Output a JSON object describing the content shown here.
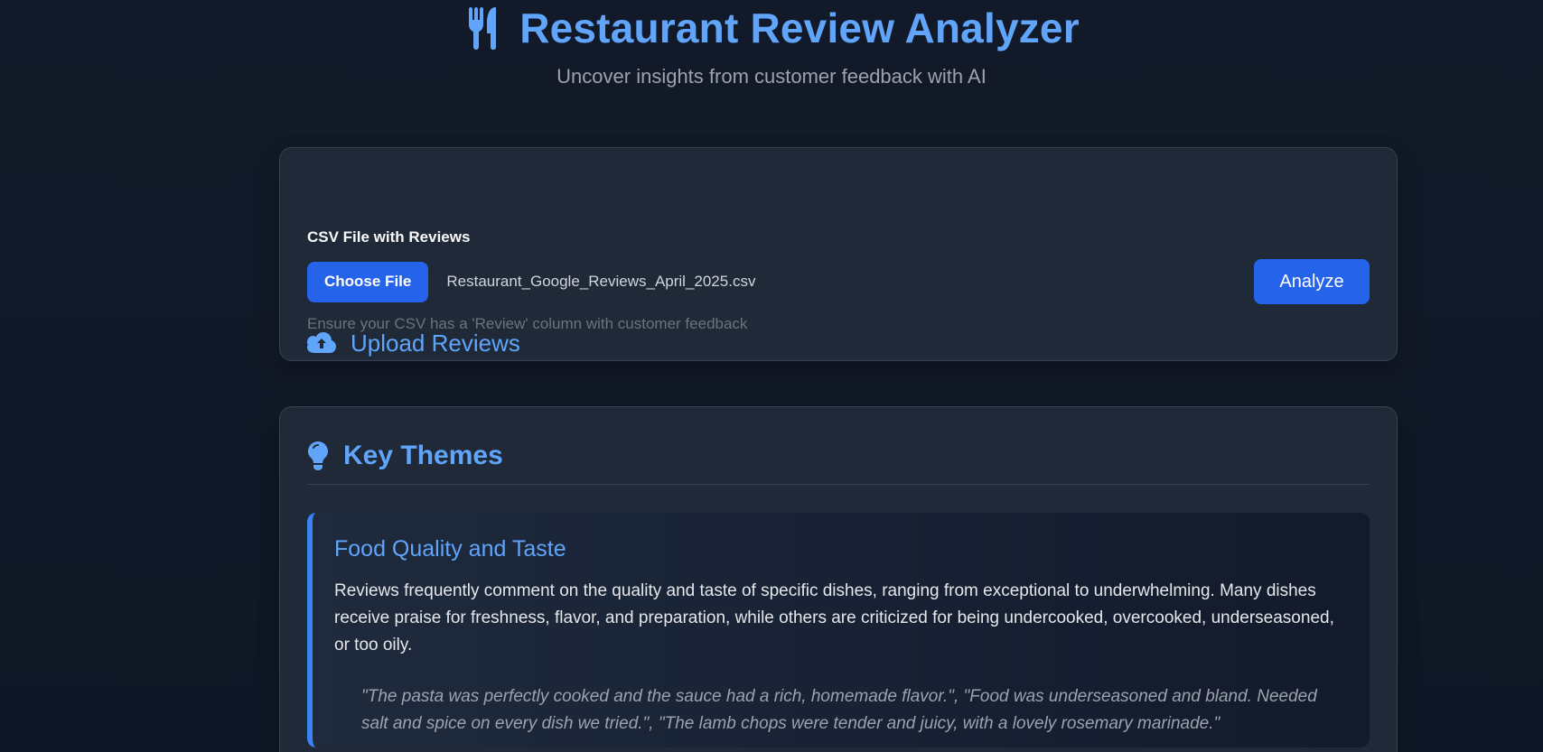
{
  "header": {
    "icon": "utensils-icon",
    "title": "Restaurant Review Analyzer",
    "subtitle": "Uncover insights from customer feedback with AI"
  },
  "upload": {
    "icon": "cloud-upload-icon",
    "heading": "Upload Reviews",
    "field_label": "CSV File with Reviews",
    "choose_file_label": "Choose File",
    "file_name": "Restaurant_Google_Reviews_April_2025.csv",
    "analyze_label": "Analyze",
    "help_text": "Ensure your CSV has a 'Review' column with customer feedback"
  },
  "themes": {
    "icon": "lightbulb-icon",
    "heading": "Key Themes",
    "items": [
      {
        "title": "Food Quality and Taste",
        "description": "Reviews frequently comment on the quality and taste of specific dishes, ranging from exceptional to underwhelming. Many dishes receive praise for freshness, flavor, and preparation, while others are criticized for being undercooked, overcooked, underseasoned, or too oily.",
        "quote": "\"The pasta was perfectly cooked and the sauce had a rich, homemade flavor.\", \"Food was underseasoned and bland. Needed salt and spice on every dish we tried.\", \"The lamb chops were tender and juicy, with a lovely rosemary marinade.\""
      }
    ]
  },
  "colors": {
    "background": "#111827",
    "card": "#1f2937",
    "accent": "#60a5fa",
    "button": "#2563eb",
    "muted": "#9ca3af"
  }
}
